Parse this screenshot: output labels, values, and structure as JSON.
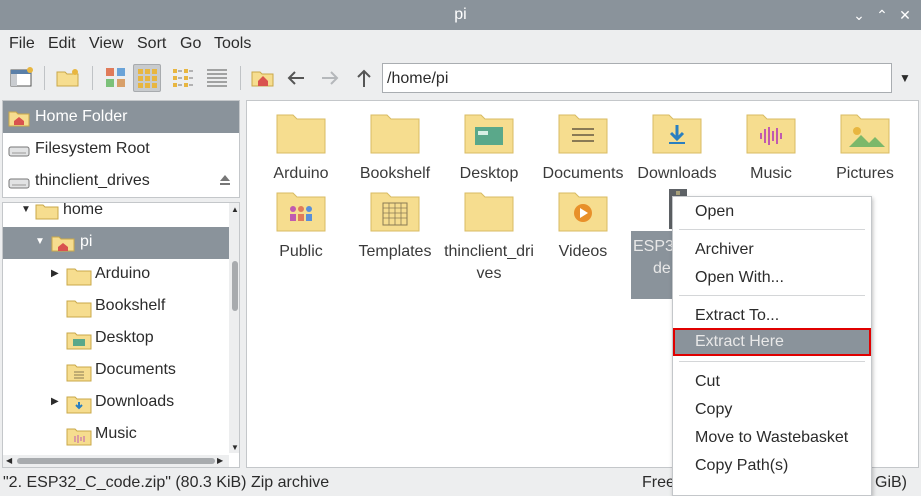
{
  "window": {
    "title": "pi"
  },
  "menubar": {
    "items": [
      "File",
      "Edit",
      "View",
      "Sort",
      "Go",
      "Tools"
    ]
  },
  "address": {
    "path": "/home/pi"
  },
  "places": [
    {
      "label": "Home Folder",
      "icon": "home-folder-icon",
      "selected": true
    },
    {
      "label": "Filesystem Root",
      "icon": "drive-icon"
    },
    {
      "label": "thinclient_drives",
      "icon": "drive-icon"
    }
  ],
  "tree": [
    {
      "label": "home",
      "level": 0,
      "expanded": true
    },
    {
      "label": "pi",
      "level": 1,
      "expanded": true,
      "selected": true,
      "icon": "home-folder-icon"
    },
    {
      "label": "Arduino",
      "level": 2,
      "has_children": true
    },
    {
      "label": "Bookshelf",
      "level": 2
    },
    {
      "label": "Desktop",
      "level": 2,
      "icon": "desktop-folder-icon"
    },
    {
      "label": "Documents",
      "level": 2,
      "icon": "documents-folder-icon"
    },
    {
      "label": "Downloads",
      "level": 2,
      "has_children": true,
      "icon": "downloads-folder-icon"
    },
    {
      "label": "Music",
      "level": 2,
      "icon": "music-folder-icon"
    }
  ],
  "files": [
    {
      "name": "Arduino",
      "icon": "folder-icon"
    },
    {
      "name": "Bookshelf",
      "icon": "folder-icon"
    },
    {
      "name": "Desktop",
      "icon": "desktop-folder-icon"
    },
    {
      "name": "Documents",
      "icon": "documents-folder-icon"
    },
    {
      "name": "Downloads",
      "icon": "downloads-folder-icon"
    },
    {
      "name": "Music",
      "icon": "music-folder-icon"
    },
    {
      "name": "Pictures",
      "icon": "pictures-folder-icon"
    },
    {
      "name": "Public",
      "icon": "public-folder-icon"
    },
    {
      "name": "Templates",
      "icon": "templates-folder-icon"
    },
    {
      "name": "thinclient_drives",
      "icon": "folder-icon"
    },
    {
      "name": "Videos",
      "icon": "videos-folder-icon"
    },
    {
      "name": "ESP3",
      "name_line2": "de",
      "icon": "zip-archive-icon",
      "selected": true
    }
  ],
  "context_menu": {
    "items": [
      {
        "label": "Open"
      },
      {
        "sep": true
      },
      {
        "label": "Archiver"
      },
      {
        "label": "Open With..."
      },
      {
        "sep": true
      },
      {
        "label": "Extract To..."
      },
      {
        "label": "Extract Here",
        "highlighted": true
      },
      {
        "sep": true
      },
      {
        "label": "Cut"
      },
      {
        "label": "Copy"
      },
      {
        "label": "Move to Wastebasket"
      },
      {
        "label": "Copy Path(s)"
      }
    ]
  },
  "status": {
    "left": "\"2. ESP32_C_code.zip\" (80.3 KiB) Zip archive",
    "right_prefix": "Free",
    "right_suffix": "GiB)"
  },
  "colors": {
    "selection": "#8a939b",
    "folder": "#f6dd8f",
    "highlight_border": "#e00000"
  }
}
